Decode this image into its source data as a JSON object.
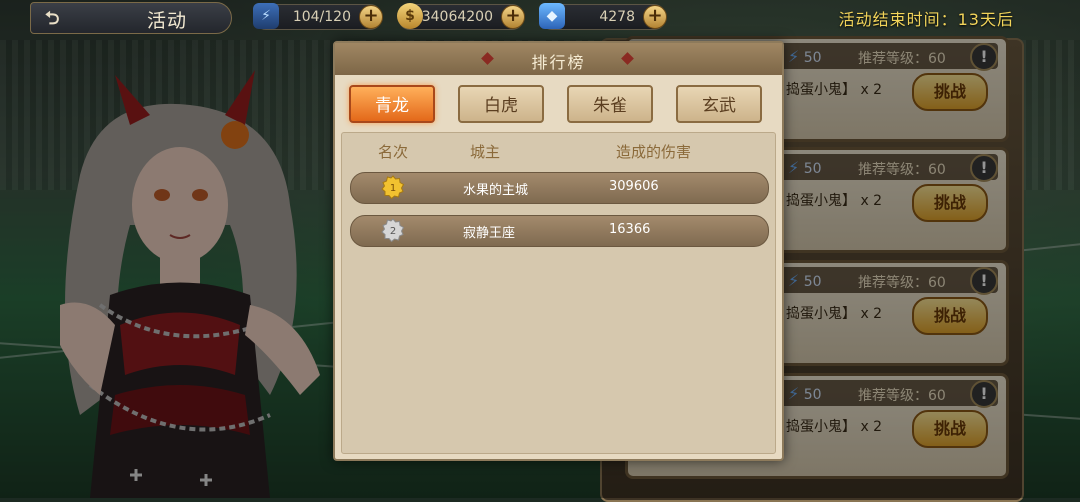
{
  "topbar": {
    "title": "活动",
    "stamina": "104/120",
    "gold": "34064200",
    "gems": "4278",
    "event_end": "活动结束时间：13天后"
  },
  "challenges": [
    {
      "stamina": "50",
      "level": "推荐等级：60",
      "reward": "捣蛋小鬼】 x 2",
      "button": "挑战"
    },
    {
      "stamina": "50",
      "level": "推荐等级：60",
      "reward": "捣蛋小鬼】 x 2",
      "button": "挑战"
    },
    {
      "stamina": "50",
      "level": "推荐等级：60",
      "reward": "捣蛋小鬼】 x 2",
      "button": "挑战"
    },
    {
      "stamina": "50",
      "level": "推荐等级：60",
      "reward": "捣蛋小鬼】 x 2",
      "button": "挑战"
    }
  ],
  "modal": {
    "title": "排行榜",
    "tabs": [
      {
        "label": "青龙",
        "active": true
      },
      {
        "label": "白虎",
        "active": false
      },
      {
        "label": "朱雀",
        "active": false
      },
      {
        "label": "玄武",
        "active": false
      }
    ],
    "headers": {
      "rank": "名次",
      "lord": "城主",
      "damage": "造成的伤害"
    },
    "rows": [
      {
        "rank": "1",
        "lord": "水果的主城",
        "damage": "309606"
      },
      {
        "rank": "2",
        "lord": "寂静王座",
        "damage": "16366"
      }
    ]
  },
  "colors": {
    "accent_tab": "#e3681a",
    "gold_medal": "#f2c230",
    "silver_medal": "#d6d6d6",
    "event_time": "#f2d45a"
  }
}
